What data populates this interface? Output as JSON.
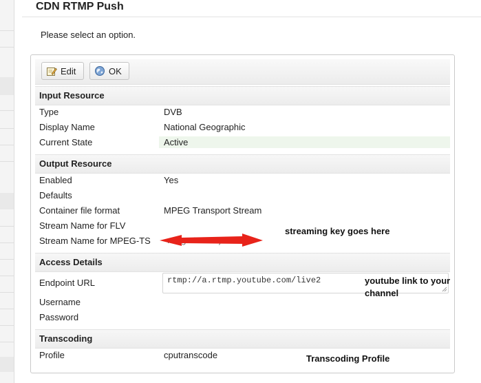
{
  "page": {
    "title": "CDN RTMP Push",
    "prompt": "Please select an option."
  },
  "toolbar": {
    "edit_label": "Edit",
    "ok_label": "OK"
  },
  "sections": {
    "input": "Input Resource",
    "output": "Output Resource",
    "access": "Access Details",
    "transcoding": "Transcoding"
  },
  "input_resource": [
    {
      "label": "Type",
      "value": "DVB"
    },
    {
      "label": "Display Name",
      "value": "National Geographic"
    },
    {
      "label": "Current State",
      "value": "Active"
    }
  ],
  "output_resource": [
    {
      "label": "Enabled",
      "value": "Yes"
    },
    {
      "label": "Defaults",
      "value": ""
    },
    {
      "label": "Container file format",
      "value": "MPEG Transport Stream"
    },
    {
      "label": "Stream Name for FLV",
      "value": ""
    },
    {
      "label": "Stream Name for MPEG-TS",
      "value": "...-7gx-f28-2...)"
    }
  ],
  "access_details": {
    "endpoint_label": "Endpoint URL",
    "endpoint_value": "rtmp://a.rtmp.youtube.com/live2",
    "username_label": "Username",
    "password_label": "Password"
  },
  "transcoding": {
    "profile_label": "Profile",
    "profile_value": "cputranscode"
  },
  "annotations": {
    "streaming_key": "streaming key goes here",
    "youtube_link_1": "youtube link to your",
    "youtube_link_2": "channel",
    "transcoding_profile": "Transcoding Profile"
  },
  "colors": {
    "active_highlight": "#eef6ec",
    "annotation_arrow": "#e8231a"
  },
  "icons": {
    "edit": "pencil-note-icon",
    "ok": "globe-icon"
  }
}
